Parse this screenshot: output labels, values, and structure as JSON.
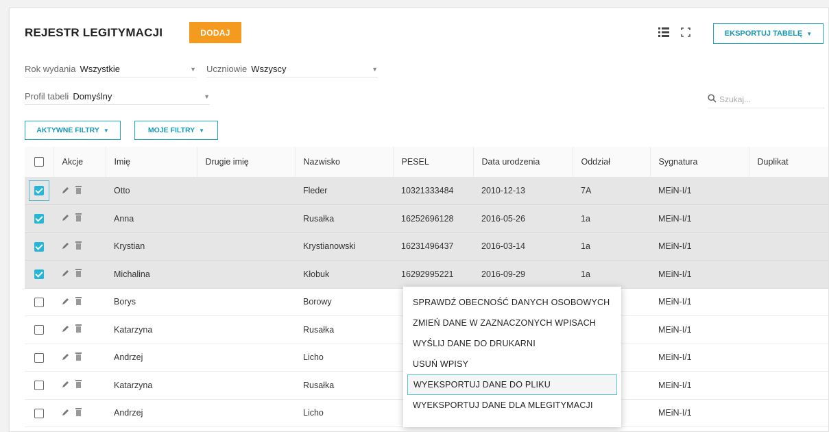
{
  "header": {
    "title": "REJESTR LEGITYMACJI",
    "add_label": "DODAJ",
    "export_label": "EKSPORTUJ TABELĘ"
  },
  "filters": {
    "year_label": "Rok wydania",
    "year_value": "Wszystkie",
    "students_label": "Uczniowie",
    "students_value": "Wszyscy",
    "profile_label": "Profil tabeli",
    "profile_value": "Domyślny",
    "search_placeholder": "Szukaj...",
    "active_filters_label": "AKTYWNE FILTRY",
    "my_filters_label": "MOJE FILTRY"
  },
  "table": {
    "headers": [
      "Akcje",
      "Imię",
      "Drugie imię",
      "Nazwisko",
      "PESEL",
      "Data urodzenia",
      "Oddział",
      "Sygnatura",
      "Duplikat"
    ],
    "rows": [
      {
        "checked": true,
        "first": "Otto",
        "middle": "",
        "last": "Fleder",
        "pesel": "10321333484",
        "dob": "2010-12-13",
        "class": "7A",
        "sig": "MEiN-I/1",
        "dup": ""
      },
      {
        "checked": true,
        "first": "Anna",
        "middle": "",
        "last": "Rusałka",
        "pesel": "16252696128",
        "dob": "2016-05-26",
        "class": "1a",
        "sig": "MEiN-I/1",
        "dup": ""
      },
      {
        "checked": true,
        "first": "Krystian",
        "middle": "",
        "last": "Krystianowski",
        "pesel": "16231496437",
        "dob": "2016-03-14",
        "class": "1a",
        "sig": "MEiN-I/1",
        "dup": ""
      },
      {
        "checked": true,
        "first": "Michalina",
        "middle": "",
        "last": "Kłobuk",
        "pesel": "16292995221",
        "dob": "2016-09-29",
        "class": "1a",
        "sig": "MEiN-I/1",
        "dup": ""
      },
      {
        "checked": false,
        "first": "Borys",
        "middle": "",
        "last": "Borowy",
        "pesel": "",
        "dob": "",
        "class": "",
        "sig": "MEiN-I/1",
        "dup": ""
      },
      {
        "checked": false,
        "first": "Katarzyna",
        "middle": "",
        "last": "Rusałka",
        "pesel": "",
        "dob": "",
        "class": "",
        "sig": "MEiN-I/1",
        "dup": ""
      },
      {
        "checked": false,
        "first": "Andrzej",
        "middle": "",
        "last": "Licho",
        "pesel": "",
        "dob": "",
        "class": "",
        "sig": "MEiN-I/1",
        "dup": ""
      },
      {
        "checked": false,
        "first": "Katarzyna",
        "middle": "",
        "last": "Rusałka",
        "pesel": "",
        "dob": "",
        "class": "",
        "sig": "MEiN-I/1",
        "dup": ""
      },
      {
        "checked": false,
        "first": "Andrzej",
        "middle": "",
        "last": "Licho",
        "pesel": "",
        "dob": "",
        "class": "",
        "sig": "MEiN-I/1",
        "dup": ""
      }
    ]
  },
  "context_menu": {
    "items": [
      "SPRAWDŹ OBECNOŚĆ DANYCH OSOBOWYCH",
      "ZMIEŃ DANE W ZAZNACZONYCH WPISACH",
      "WYŚLIJ DANE DO DRUKARNI",
      "USUŃ WPISY",
      "WYEKSPORTUJ DANE DO PLIKU",
      "WYEKSPORTUJ DANE DLA MLEGITYMACJI"
    ],
    "highlighted_index": 4
  },
  "colors": {
    "accent": "#1aa6c4",
    "add_button": "#f39a1f",
    "checkbox_checked": "#25b6d6",
    "selected_row": "#e6e6e6"
  },
  "icons": {
    "list_view": "list-view-icon",
    "fullscreen": "fullscreen-icon",
    "edit": "pencil-icon",
    "delete": "trash-icon",
    "search": "search-icon",
    "dropdown": "caret-down-icon"
  }
}
